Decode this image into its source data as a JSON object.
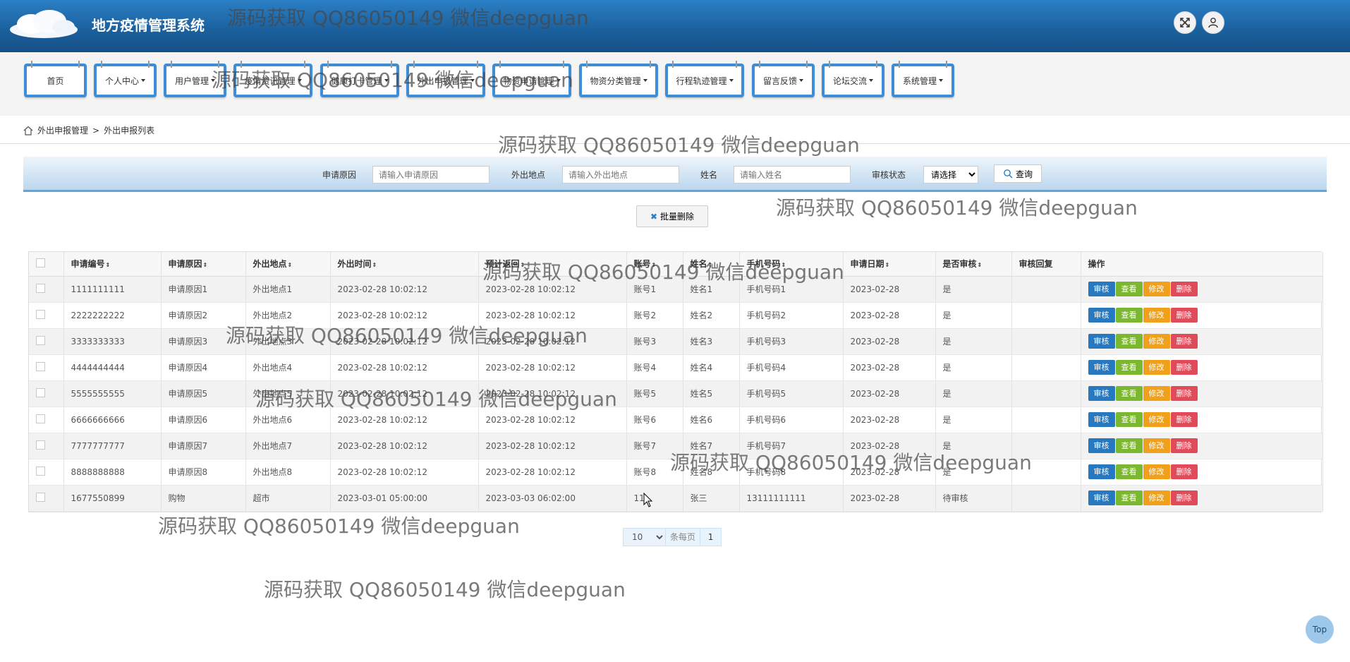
{
  "header": {
    "title": "地方疫情管理系统"
  },
  "nav": [
    {
      "label": "首页",
      "dropdown": false
    },
    {
      "label": "个人中心",
      "dropdown": true
    },
    {
      "label": "用户管理",
      "dropdown": true
    },
    {
      "label": "疫情资讯管理",
      "dropdown": true
    },
    {
      "label": "健康打卡管理",
      "dropdown": true
    },
    {
      "label": "外出申报管理",
      "dropdown": true
    },
    {
      "label": "物资申请管理",
      "dropdown": true
    },
    {
      "label": "物资分类管理",
      "dropdown": true
    },
    {
      "label": "行程轨迹管理",
      "dropdown": true
    },
    {
      "label": "留言反馈",
      "dropdown": true
    },
    {
      "label": "论坛交流",
      "dropdown": true
    },
    {
      "label": "系统管理",
      "dropdown": true
    }
  ],
  "breadcrumb": {
    "level1": "外出申报管理",
    "separator": ">",
    "level2": "外出申报列表"
  },
  "search": {
    "reason_label": "申请原因",
    "reason_placeholder": "请输入申请原因",
    "place_label": "外出地点",
    "place_placeholder": "请输入外出地点",
    "name_label": "姓名",
    "name_placeholder": "请输入姓名",
    "status_label": "审核状态",
    "status_selected": "请选择",
    "query_label": "查询"
  },
  "batch_delete_label": "批量删除",
  "table": {
    "headers": [
      "申请编号",
      "申请原因",
      "外出地点",
      "外出时间",
      "预计返回",
      "账号",
      "姓名",
      "手机号码",
      "申请日期",
      "是否审核",
      "审核回复",
      "操作"
    ],
    "actions": [
      "审核",
      "查看",
      "修改",
      "删除"
    ],
    "rows": [
      [
        "1111111111",
        "申请原因1",
        "外出地点1",
        "2023-02-28 10:02:12",
        "2023-02-28 10:02:12",
        "账号1",
        "姓名1",
        "手机号码1",
        "2023-02-28",
        "是",
        ""
      ],
      [
        "2222222222",
        "申请原因2",
        "外出地点2",
        "2023-02-28 10:02:12",
        "2023-02-28 10:02:12",
        "账号2",
        "姓名2",
        "手机号码2",
        "2023-02-28",
        "是",
        ""
      ],
      [
        "3333333333",
        "申请原因3",
        "外出地点3",
        "2023-02-28 10:02:12",
        "2023-02-28 10:02:12",
        "账号3",
        "姓名3",
        "手机号码3",
        "2023-02-28",
        "是",
        ""
      ],
      [
        "4444444444",
        "申请原因4",
        "外出地点4",
        "2023-02-28 10:02:12",
        "2023-02-28 10:02:12",
        "账号4",
        "姓名4",
        "手机号码4",
        "2023-02-28",
        "是",
        ""
      ],
      [
        "5555555555",
        "申请原因5",
        "外出地点5",
        "2023-02-28 10:02:12",
        "2023-02-28 10:02:12",
        "账号5",
        "姓名5",
        "手机号码5",
        "2023-02-28",
        "是",
        ""
      ],
      [
        "6666666666",
        "申请原因6",
        "外出地点6",
        "2023-02-28 10:02:12",
        "2023-02-28 10:02:12",
        "账号6",
        "姓名6",
        "手机号码6",
        "2023-02-28",
        "是",
        ""
      ],
      [
        "7777777777",
        "申请原因7",
        "外出地点7",
        "2023-02-28 10:02:12",
        "2023-02-28 10:02:12",
        "账号7",
        "姓名7",
        "手机号码7",
        "2023-02-28",
        "是",
        ""
      ],
      [
        "8888888888",
        "申请原因8",
        "外出地点8",
        "2023-02-28 10:02:12",
        "2023-02-28 10:02:12",
        "账号8",
        "姓名8",
        "手机号码8",
        "2023-02-28",
        "是",
        ""
      ],
      [
        "1677550899",
        "购物",
        "超市",
        "2023-03-01 05:00:00",
        "2023-03-03 06:02:00",
        "11",
        "张三",
        "13111111111",
        "2023-02-28",
        "待审核",
        ""
      ]
    ]
  },
  "pager": {
    "page_size": "10",
    "per_page_label": "条每页",
    "current_page": "1"
  },
  "top_button_label": "Top",
  "watermark_text": "源码获取 QQ86050149 微信deepguan",
  "colors": {
    "header_blue": "#1a5f9c",
    "review": "#2878c0",
    "view": "#7cb82f",
    "edit": "#f0a01a",
    "delete": "#e04a59"
  }
}
